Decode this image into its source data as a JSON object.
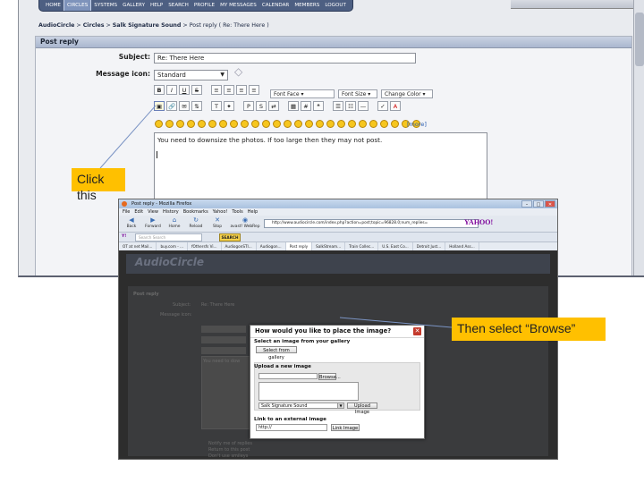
{
  "top_screenshot": {
    "nav_items": [
      "HOME",
      "CIRCLES",
      "SYSTEMS",
      "GALLERY",
      "HELP",
      "SEARCH",
      "PROFILE",
      "MY MESSAGES",
      "CALENDAR",
      "MEMBERS",
      "LOGOUT"
    ],
    "active_nav": "CIRCLES",
    "breadcrumb": {
      "root": "AudioCircle",
      "sep": " > ",
      "circles": "Circles",
      "group": "Salk Signature Sound",
      "tail": "Post reply ( Re: There Here )"
    },
    "panel_title": "Post reply",
    "subject_label": "Subject:",
    "subject_value": "Re: There Here",
    "message_icon_label": "Message icon:",
    "message_icon_value": "Standard",
    "font_face": "Font Face",
    "font_size": "Font Size",
    "change_color": "Change Color",
    "more_link": "[more]",
    "message_text": "You need to downsize the photos.  If too large then they may not post."
  },
  "callouts": {
    "first": "Click this",
    "second": "Then select “Browse”"
  },
  "browser": {
    "window_title": "Post reply - Mozilla Firefox",
    "menu": [
      "File",
      "Edit",
      "View",
      "History",
      "Bookmarks",
      "Yahoo!",
      "Tools",
      "Help"
    ],
    "nav_buttons": [
      "Back",
      "Forward",
      "Home",
      "Reload",
      "Stop",
      "avast! WebRep"
    ],
    "url": "http://www.audiocircle.com/index.php?action=post;topic=96828.0;num_replies=",
    "yahoo_brand": "YAHOO!",
    "yahoo_search_placeholder": "Yahoo",
    "search_web_placeholder": "Search Search",
    "search_button": "SEARCH",
    "bookmarks": [
      "OT at net Mail...",
      "buy.com - ...",
      "fOthersfs Vi...",
      "AudiogonSTI...",
      "Audiogon...",
      "Post reply",
      "SalkStream...",
      "Train Collec...",
      "U.S. East Co...",
      "Detroit Just...",
      "Holland Ass..."
    ],
    "site_logo": "AudioCircle",
    "dim_subject_label": "Subject:",
    "dim_subject_value": "Re: There Here",
    "dim_message_icon_label": "Message icon:",
    "dim_post_reply": "Post reply",
    "dim_you_need": "You need to dow",
    "dim_options": [
      "Notify me of replies",
      "Return to this post",
      "Don't use smileys"
    ]
  },
  "modal": {
    "title": "How would you like to place the image?",
    "gallery_heading": "Select an image from your gallery",
    "gallery_button": "Select from gallery",
    "upload_heading": "Upload a new image",
    "browse_button": "Browse...",
    "circle_value": "Salk Signature Sound",
    "upload_button": "Upload Image",
    "link_heading": "Link to an external image",
    "link_value": "http://",
    "link_button": "Link Image"
  }
}
